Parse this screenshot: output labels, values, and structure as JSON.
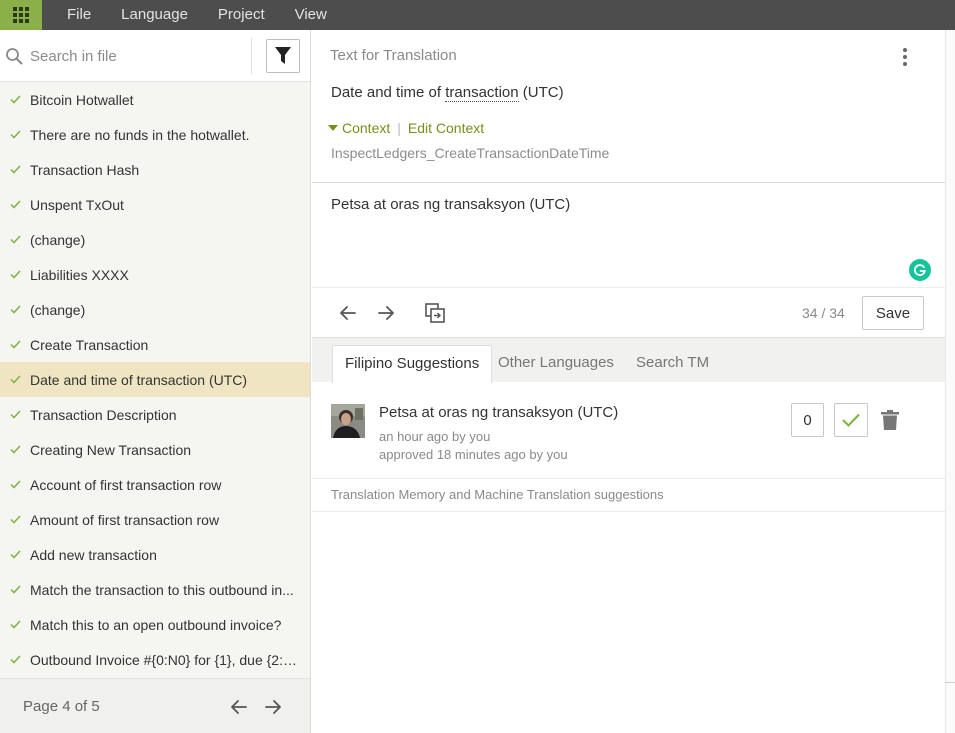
{
  "menubar": {
    "items": [
      "File",
      "Language",
      "Project",
      "View"
    ]
  },
  "sidebar": {
    "search_placeholder": "Search in file",
    "items": [
      {
        "label": "Bitcoin Hotwallet",
        "done": true
      },
      {
        "label": "There are no funds in the hotwallet.",
        "done": true
      },
      {
        "label": "Transaction Hash",
        "done": true
      },
      {
        "label": "Unspent TxOut",
        "done": true
      },
      {
        "label": "(change)",
        "done": true
      },
      {
        "label": "Liabilities XXXX",
        "done": true
      },
      {
        "label": "(change)",
        "done": true
      },
      {
        "label": "Create Transaction",
        "done": true
      },
      {
        "label": "Date and time of transaction (UTC)",
        "done": true,
        "active": true
      },
      {
        "label": "Transaction Description",
        "done": true
      },
      {
        "label": "Creating New Transaction",
        "done": true
      },
      {
        "label": "Account of first transaction row",
        "done": true
      },
      {
        "label": "Amount of first transaction row",
        "done": true
      },
      {
        "label": "Add new transaction",
        "done": true
      },
      {
        "label": "Match the transaction to this outbound in...",
        "done": true
      },
      {
        "label": "Match this to an open outbound invoice?",
        "done": true
      },
      {
        "label": "Outbound Invoice #{0:N0} for {1}, due {2:y...",
        "done": true
      }
    ],
    "pager": {
      "label": "Page 4 of 5"
    }
  },
  "source": {
    "header": "Text for Translation",
    "text_before": "Date and time of ",
    "text_term": "transaction",
    "text_after": " (UTC)",
    "context_label": "Context",
    "edit_context_label": "Edit Context",
    "context_key": "InspectLedgers_CreateTransactionDateTime"
  },
  "translation": {
    "text": "Petsa at oras ng transaksyon (UTC)",
    "counter": "34 / 34",
    "save_label": "Save"
  },
  "tabs": [
    "Filipino Suggestions",
    "Other Languages",
    "Search TM"
  ],
  "suggestions": [
    {
      "text": "Petsa at oras ng transaksyon (UTC)",
      "meta1": "an hour ago by you",
      "meta2": "approved 18 minutes ago by you",
      "votes": "0"
    }
  ],
  "tm_note": "Translation Memory and Machine Translation suggestions",
  "colors": {
    "accent_green": "#8bb04a",
    "context_olive": "#7c8c1c",
    "active_row": "#efe5c2",
    "menubar": "#4d4d4d"
  }
}
